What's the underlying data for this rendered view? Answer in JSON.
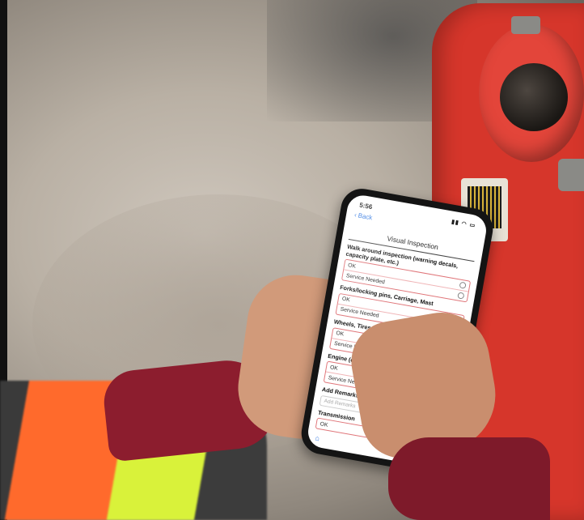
{
  "phone": {
    "status_time": "5:56",
    "status_icons": "▮▮ ◠ ▭",
    "back_label": "Back",
    "nav_title": "Visual Inspection",
    "sections": [
      {
        "title": "Walk around inspection (warning decals, capacity plate, etc.)",
        "options": [
          "OK",
          "Service Needed"
        ]
      },
      {
        "title": "Forks/locking pins, Carriage, Mast",
        "options": [
          "OK",
          "Service Needed"
        ]
      },
      {
        "title": "Wheels, Tires & Lug Nuts (condition/pressure)",
        "options": [
          "OK",
          "Service Needed"
        ]
      },
      {
        "title": "Engine (check oil level and for leaks)",
        "options": [
          "OK",
          "Service Needed"
        ]
      }
    ],
    "remarks_title": "Add Remarks",
    "remarks_placeholder": "Add Remarks",
    "last_section_title": "Transmission",
    "last_section_option": "OK",
    "tab_icon": "home-icon"
  },
  "colors": {
    "accent": "#2a73e0",
    "option_border": "#e0767a",
    "machine_red": "#d6362b"
  }
}
